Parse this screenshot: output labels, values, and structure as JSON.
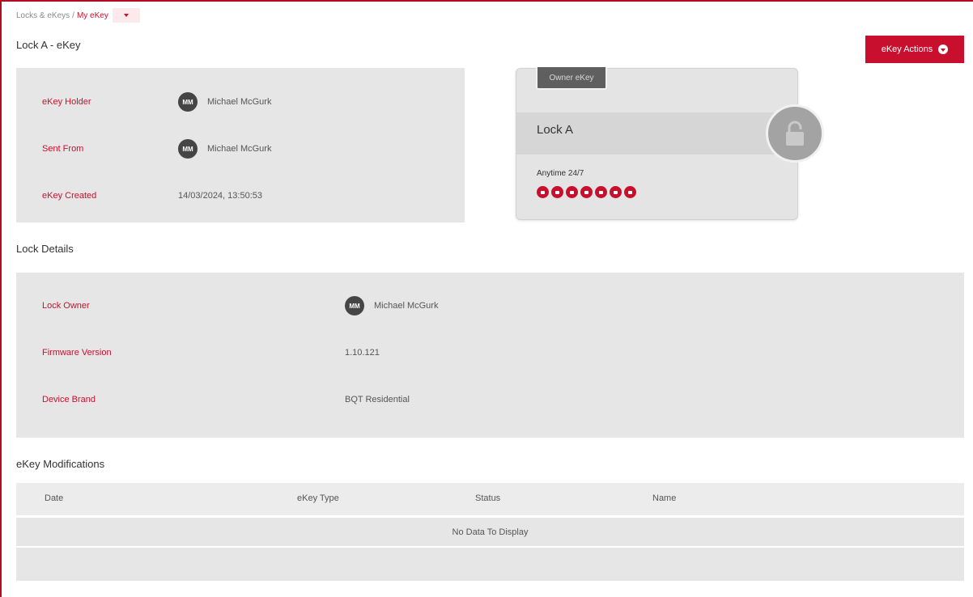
{
  "breadcrumb": {
    "parent": "Locks & eKeys",
    "separator": "/",
    "current": "My eKey"
  },
  "page_title": "Lock A - eKey",
  "actions_button": {
    "label": "eKey Actions"
  },
  "ekey_info": [
    {
      "label": "eKey Holder",
      "avatar": "MM",
      "value": "Michael McGurk"
    },
    {
      "label": "Sent From",
      "avatar": "MM",
      "value": "Michael McGurk"
    },
    {
      "label": "eKey Created",
      "value": "14/03/2024, 13:50:53"
    }
  ],
  "card": {
    "tag": "Owner eKey",
    "lock_name": "Lock A",
    "schedule": "Anytime 24/7",
    "days_active": 7,
    "lock_icon": "padlock-icon"
  },
  "lock_details": {
    "title": "Lock Details",
    "rows": [
      {
        "label": "Lock Owner",
        "avatar": "MM",
        "value": "Michael McGurk"
      },
      {
        "label": "Firmware Version",
        "value": "1.10.121"
      },
      {
        "label": "Device Brand",
        "value": "BQT Residential"
      }
    ]
  },
  "modifications": {
    "title": "eKey Modifications",
    "columns": [
      "Date",
      "eKey Type",
      "Status",
      "Name"
    ],
    "empty_text": "No Data To Display"
  },
  "colors": {
    "accent": "#c8102e",
    "panel": "#e6e6e6",
    "avatar": "#454545"
  }
}
